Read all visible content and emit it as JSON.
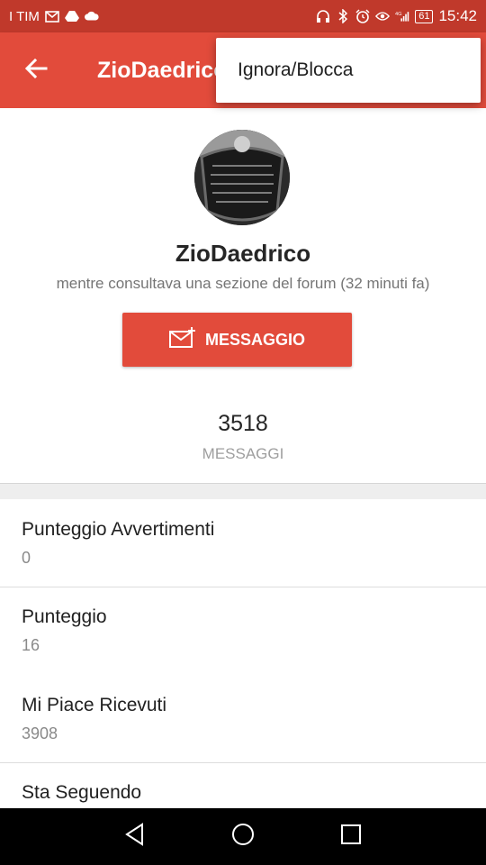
{
  "status_bar": {
    "carrier": "I TIM",
    "battery": "61",
    "time": "15:42",
    "left_icons": [
      "gmail-icon",
      "drive-icon",
      "cloud-icon"
    ],
    "right_icons": [
      "headphones-icon",
      "bluetooth-icon",
      "alarm-icon",
      "eye-icon",
      "signal-4g-icon"
    ]
  },
  "app_bar": {
    "title": "ZioDaedrico",
    "back_icon": "arrow-back-icon"
  },
  "menu": {
    "items": [
      {
        "label": "Ignora/Blocca"
      }
    ]
  },
  "profile": {
    "username": "ZioDaedrico",
    "status": "mentre consultava una sezione del forum (32 minuti fa)",
    "message_button": "MESSAGGIO",
    "stats": [
      {
        "value": "3518",
        "label": "MESSAGGI"
      }
    ]
  },
  "details": [
    {
      "title": "Punteggio Avvertimenti",
      "value": "0"
    },
    {
      "title": "Punteggio",
      "value": "16"
    },
    {
      "title": "Mi Piace Ricevuti",
      "value": "3908"
    },
    {
      "title": "Sta Seguendo",
      "value": ""
    }
  ],
  "colors": {
    "status_bar": "#c0392b",
    "app_bar": "#e24b3b",
    "accent": "#e24b3b"
  }
}
